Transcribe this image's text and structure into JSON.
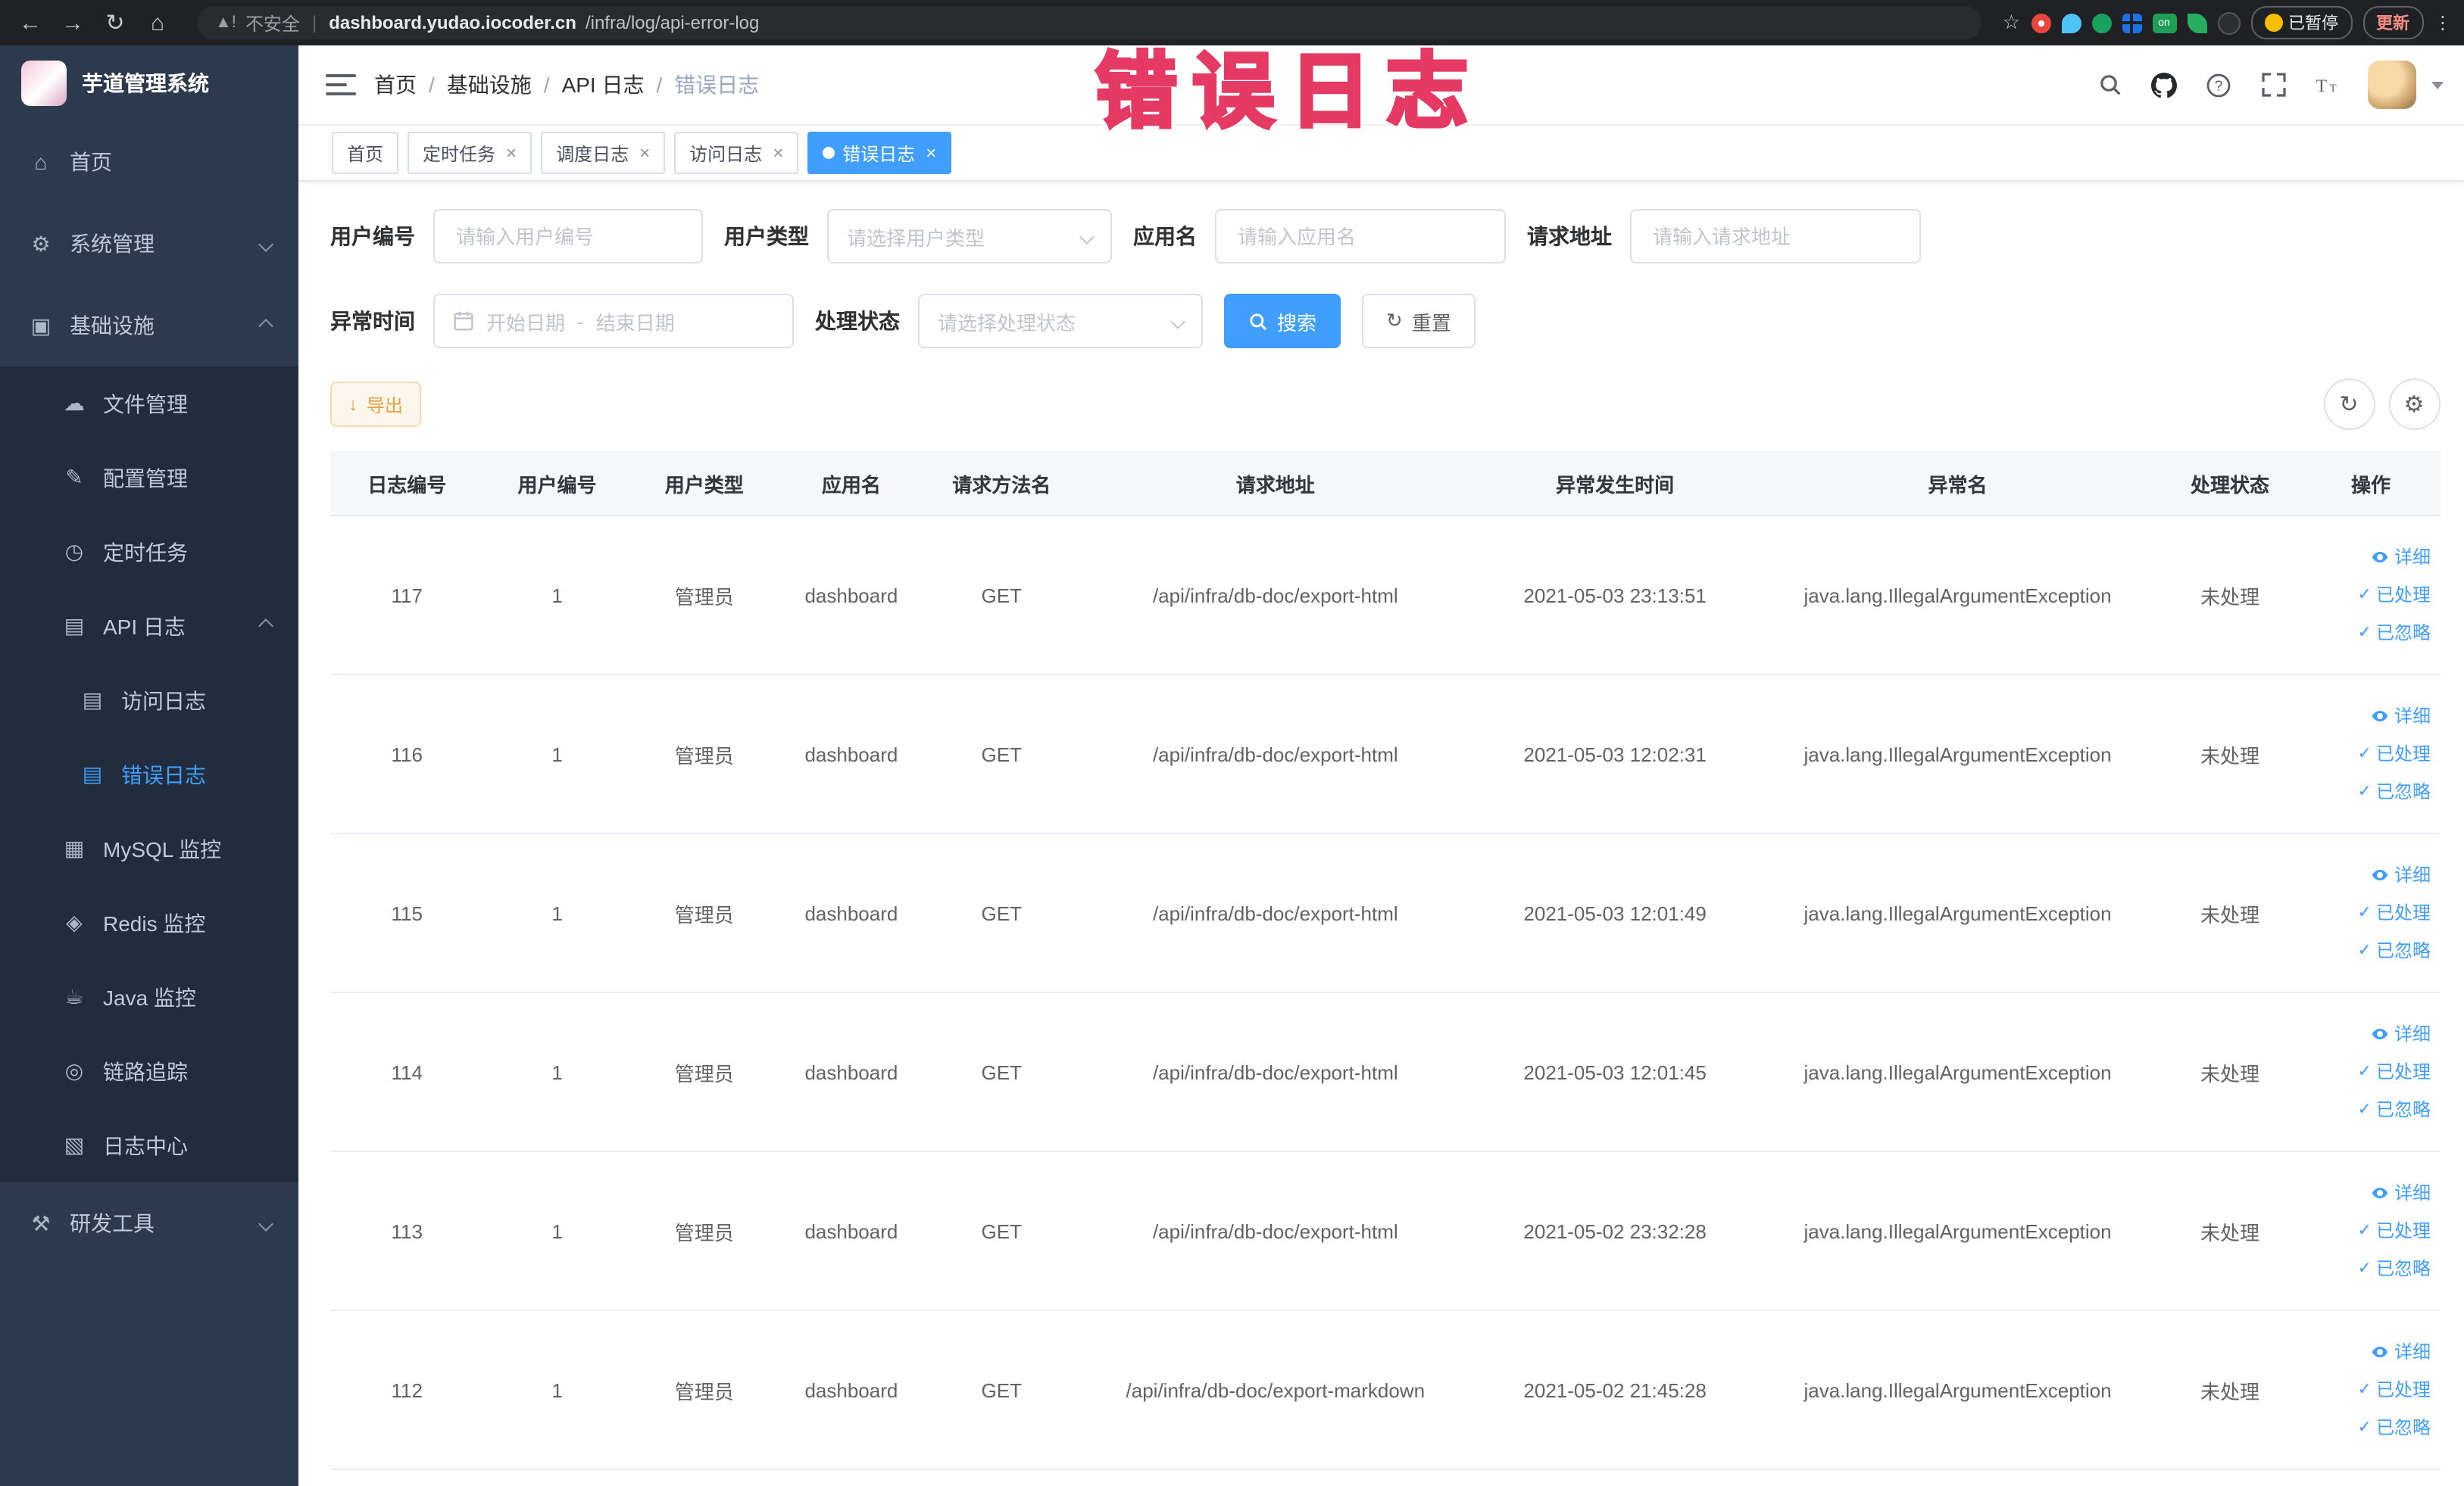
{
  "colors": {
    "accent": "#409eff",
    "warning": "#e6a23c",
    "annotation": "#ee4468",
    "sidebar_bg": "#2d3a4d",
    "submenu_bg": "#212d3d",
    "active_tab_bg": "#409eff"
  },
  "annotation_text": "错误日志",
  "browser": {
    "security_label": "不安全",
    "url_domain": "dashboard.yudao.iocoder.cn",
    "url_path": "/infra/log/api-error-log",
    "paused_badge": "已暂停",
    "update_button": "更新",
    "on_badge": "on"
  },
  "sidebar": {
    "logo_title": "芋道管理系统",
    "items": [
      {
        "label": "首页"
      },
      {
        "label": "系统管理"
      },
      {
        "label": "基础设施",
        "children": [
          {
            "label": "文件管理"
          },
          {
            "label": "配置管理"
          },
          {
            "label": "定时任务"
          },
          {
            "label": "API 日志",
            "children": [
              {
                "label": "访问日志"
              },
              {
                "label": "错误日志"
              }
            ]
          },
          {
            "label": "MySQL 监控"
          },
          {
            "label": "Redis 监控"
          },
          {
            "label": "Java 监控"
          },
          {
            "label": "链路追踪"
          },
          {
            "label": "日志中心"
          }
        ]
      },
      {
        "label": "研发工具"
      }
    ]
  },
  "breadcrumb": {
    "items": [
      "首页",
      "基础设施",
      "API 日志",
      "错误日志"
    ]
  },
  "tabs": [
    {
      "label": "首页"
    },
    {
      "label": "定时任务"
    },
    {
      "label": "调度日志"
    },
    {
      "label": "访问日志"
    },
    {
      "label": "错误日志"
    }
  ],
  "filters": {
    "user_id": {
      "label": "用户编号",
      "placeholder": "请输入用户编号"
    },
    "user_type": {
      "label": "用户类型",
      "placeholder": "请选择用户类型"
    },
    "app_name": {
      "label": "应用名",
      "placeholder": "请输入应用名"
    },
    "request_url": {
      "label": "请求地址",
      "placeholder": "请输入请求地址"
    },
    "exception_time": {
      "label": "异常时间",
      "start_placeholder": "开始日期",
      "separator": "-",
      "end_placeholder": "结束日期"
    },
    "process_status": {
      "label": "处理状态",
      "placeholder": "请选择处理状态"
    },
    "search_label": "搜索",
    "reset_label": "重置"
  },
  "toolbar": {
    "export_label": "导出"
  },
  "table": {
    "headers": [
      "日志编号",
      "用户编号",
      "用户类型",
      "应用名",
      "请求方法名",
      "请求地址",
      "异常发生时间",
      "异常名",
      "处理状态",
      "操作"
    ],
    "action_labels": {
      "detail": "详细",
      "processed": "已处理",
      "ignore": "已忽略"
    },
    "rows": [
      {
        "log_id": "117",
        "user_id": "1",
        "user_type": "管理员",
        "app_name": "dashboard",
        "method": "GET",
        "url": "/api/infra/db-doc/export-html",
        "time": "2021-05-03 23:13:51",
        "exception": "java.lang.IllegalArgumentException",
        "status": "未处理"
      },
      {
        "log_id": "116",
        "user_id": "1",
        "user_type": "管理员",
        "app_name": "dashboard",
        "method": "GET",
        "url": "/api/infra/db-doc/export-html",
        "time": "2021-05-03 12:02:31",
        "exception": "java.lang.IllegalArgumentException",
        "status": "未处理"
      },
      {
        "log_id": "115",
        "user_id": "1",
        "user_type": "管理员",
        "app_name": "dashboard",
        "method": "GET",
        "url": "/api/infra/db-doc/export-html",
        "time": "2021-05-03 12:01:49",
        "exception": "java.lang.IllegalArgumentException",
        "status": "未处理"
      },
      {
        "log_id": "114",
        "user_id": "1",
        "user_type": "管理员",
        "app_name": "dashboard",
        "method": "GET",
        "url": "/api/infra/db-doc/export-html",
        "time": "2021-05-03 12:01:45",
        "exception": "java.lang.IllegalArgumentException",
        "status": "未处理"
      },
      {
        "log_id": "113",
        "user_id": "1",
        "user_type": "管理员",
        "app_name": "dashboard",
        "method": "GET",
        "url": "/api/infra/db-doc/export-html",
        "time": "2021-05-02 23:32:28",
        "exception": "java.lang.IllegalArgumentException",
        "status": "未处理"
      },
      {
        "log_id": "112",
        "user_id": "1",
        "user_type": "管理员",
        "app_name": "dashboard",
        "method": "GET",
        "url": "/api/infra/db-doc/export-markdown",
        "time": "2021-05-02 21:45:28",
        "exception": "java.lang.IllegalArgumentException",
        "status": "未处理"
      }
    ]
  }
}
